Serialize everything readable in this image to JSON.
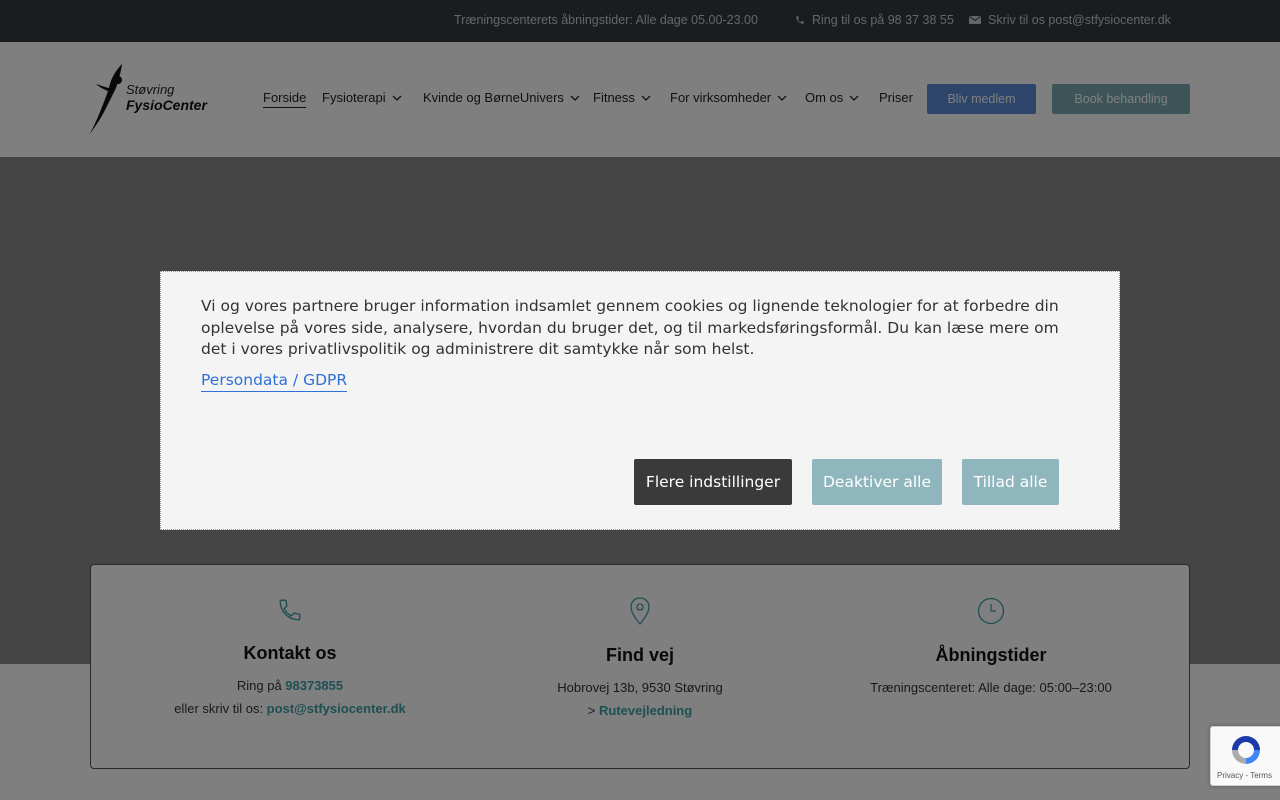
{
  "topbar": {
    "hours": "Træningscenterets åbningstider: Alle dage 05.00-23.00",
    "phone": "Ring til os på 98 37 38 55",
    "email": "Skriv til os post@stfysiocenter.dk"
  },
  "logo": {
    "line1": "Støvring",
    "line2": "FysioCenter"
  },
  "nav": {
    "items": [
      {
        "label": "Forside"
      },
      {
        "label": "Fysioterapi"
      },
      {
        "label": "Kvinde og BørneUnivers"
      },
      {
        "label": "Fitness"
      },
      {
        "label": "For virksomheder"
      },
      {
        "label": "Om os"
      },
      {
        "label": "Priser"
      }
    ],
    "member_button": "Bliv medlem",
    "book_button": "Book behandling"
  },
  "info": {
    "contact": {
      "title": "Kontakt os",
      "line1_prefix": "Ring på ",
      "phone": "98373855",
      "line2_prefix": "eller skriv til os: ",
      "email": "post@stfysiocenter.dk"
    },
    "directions": {
      "title": "Find vej",
      "address": "Hobrovej 13b, 9530 Støvring",
      "link_prefix": "> ",
      "link": "Rutevejledning"
    },
    "hours": {
      "title": "Åbningstider",
      "line": "Træningscenteret: Alle dage: 05:00–23:00"
    }
  },
  "cookie": {
    "text": "Vi og vores partnere bruger information indsamlet gennem cookies og lignende teknologier for at forbedre din oplevelse på vores side, analysere, hvordan du bruger det, og til markedsføringsformål. Du kan læse mere om det i vores privatlivspolitik og administrere dit samtykke når som helst.",
    "link": "Persondata / GDPR",
    "more_settings": "Flere indstillinger",
    "deny_all": "Deaktiver alle",
    "allow_all": "Tillad alle"
  },
  "recaptcha": {
    "terms": "Privacy - Terms"
  },
  "colors": {
    "topbar": "#343a3f",
    "accent_blue": "#5b8ad6",
    "accent_teal": "#7aaab0",
    "link_teal": "#3c9fa6",
    "gdpr_link": "#2f6fd6"
  }
}
